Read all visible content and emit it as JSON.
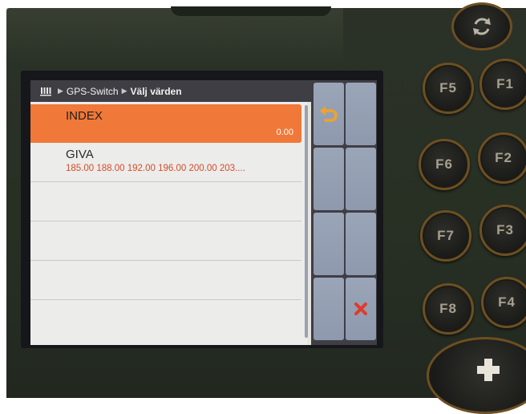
{
  "breadcrumb": {
    "root_icon": "field-grid-icon",
    "items": [
      "GPS-Switch",
      "Välj värden"
    ]
  },
  "list": {
    "rows": [
      {
        "name": "INDEX",
        "value": "0.00",
        "selected": true
      },
      {
        "name": "GIVA",
        "value": "185.00 188.00 192.00 196.00 200.00 203....",
        "selected": false
      },
      {
        "name": "",
        "value": ""
      },
      {
        "name": "",
        "value": ""
      },
      {
        "name": "",
        "value": ""
      }
    ]
  },
  "softkeys": {
    "back_icon": "undo-arrow-icon",
    "cancel_icon": "close-x-icon"
  },
  "device_keys": {
    "left_column": [
      "F5",
      "F6",
      "F7",
      "F8"
    ],
    "right_column": [
      "F1",
      "F2",
      "F3",
      "F4"
    ],
    "rotate_icon": "rotate-icon",
    "plus_icon": "plus-icon"
  },
  "colors": {
    "selection": "#f07838",
    "value_text": "#d54b2a",
    "key_ring": "#6d4f21",
    "cancel": "#e03a2c",
    "back": "#f0a22a"
  }
}
